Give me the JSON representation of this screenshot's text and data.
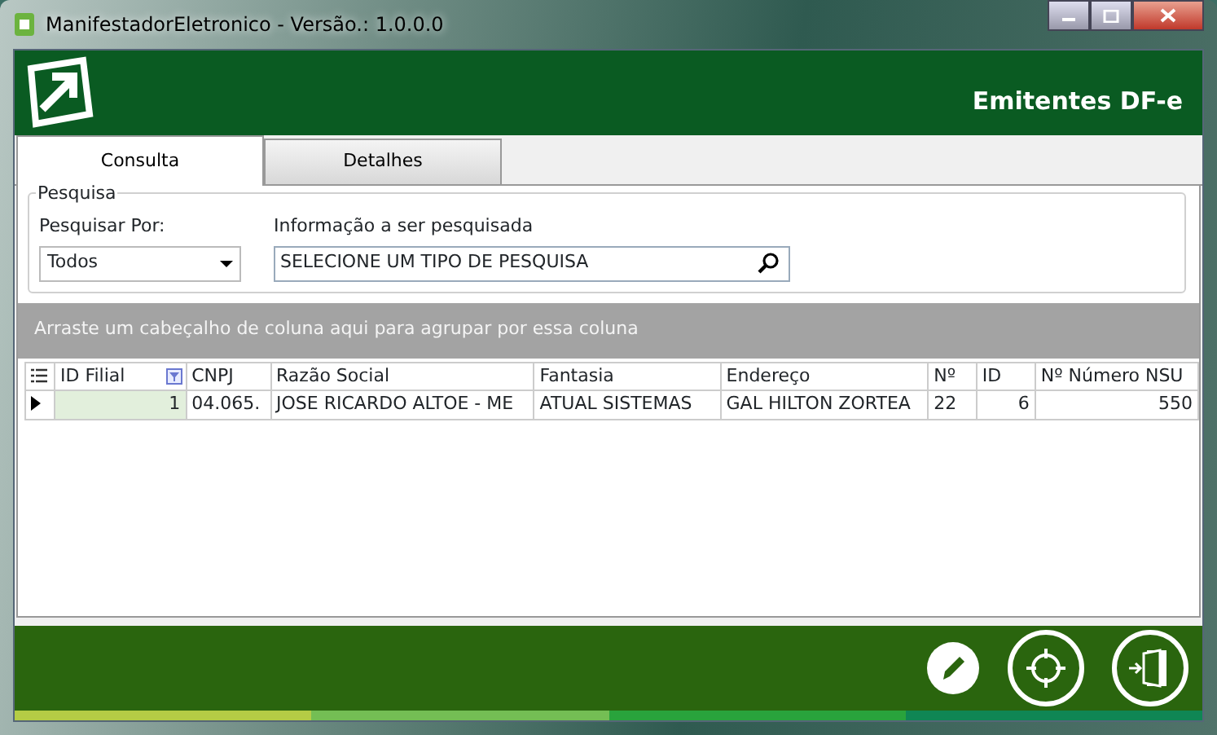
{
  "window": {
    "title": "ManifestadorEletronico - Versão.: 1.0.0.0"
  },
  "header": {
    "title": "Emitentes DF-e"
  },
  "tabs": [
    {
      "label": "Consulta",
      "selected": true
    },
    {
      "label": "Detalhes",
      "selected": false
    }
  ],
  "search": {
    "group_title": "Pesquisa",
    "by_label": "Pesquisar Por:",
    "by_value": "Todos",
    "info_label": "Informação a ser pesquisada",
    "info_value": "SELECIONE UM TIPO DE PESQUISA"
  },
  "grid": {
    "group_panel": "Arraste um cabeçalho de coluna aqui para agrupar por essa coluna",
    "columns": [
      {
        "label": "ID Filial",
        "filtered": true
      },
      {
        "label": "CNPJ",
        "filtered": false
      },
      {
        "label": "Razão Social",
        "filtered": false
      },
      {
        "label": "Fantasia",
        "filtered": false
      },
      {
        "label": "Endereço",
        "filtered": false
      },
      {
        "label": "Nº",
        "filtered": false
      },
      {
        "label": "ID",
        "filtered": false
      },
      {
        "label": "Nº Número NSU",
        "filtered": false
      }
    ],
    "rows": [
      {
        "selected": true,
        "cells": [
          "1",
          "04.065.",
          "JOSE RICARDO ALTOE - ME",
          "ATUAL SISTEMAS",
          "GAL HILTON ZORTEA",
          "22",
          "6",
          "550"
        ]
      }
    ]
  }
}
